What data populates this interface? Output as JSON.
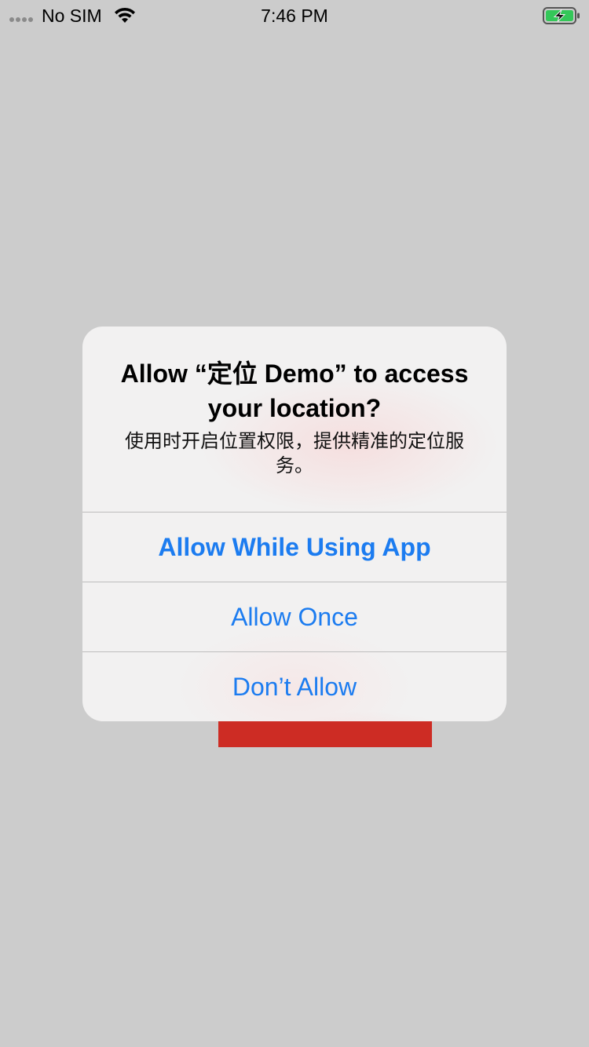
{
  "status_bar": {
    "carrier": "No SIM",
    "time": "7:46 PM",
    "signal_icon": "signal-dots-icon",
    "wifi_icon": "wifi-icon",
    "battery_icon": "battery-charging-icon"
  },
  "alert": {
    "title": "Allow “定位 Demo” to access your location?",
    "message": "使用时开启位置权限，提供精准的定位服务。",
    "buttons": [
      {
        "label": "Allow While Using App",
        "style": "bold"
      },
      {
        "label": "Allow Once",
        "style": "regular"
      },
      {
        "label": "Don’t Allow",
        "style": "regular"
      }
    ]
  },
  "colors": {
    "background": "#cccccc",
    "alert_background": "#f2f1f1",
    "button_text": "#1c7cf0",
    "red_element": "#cd2c24",
    "battery_green": "#34c759"
  }
}
